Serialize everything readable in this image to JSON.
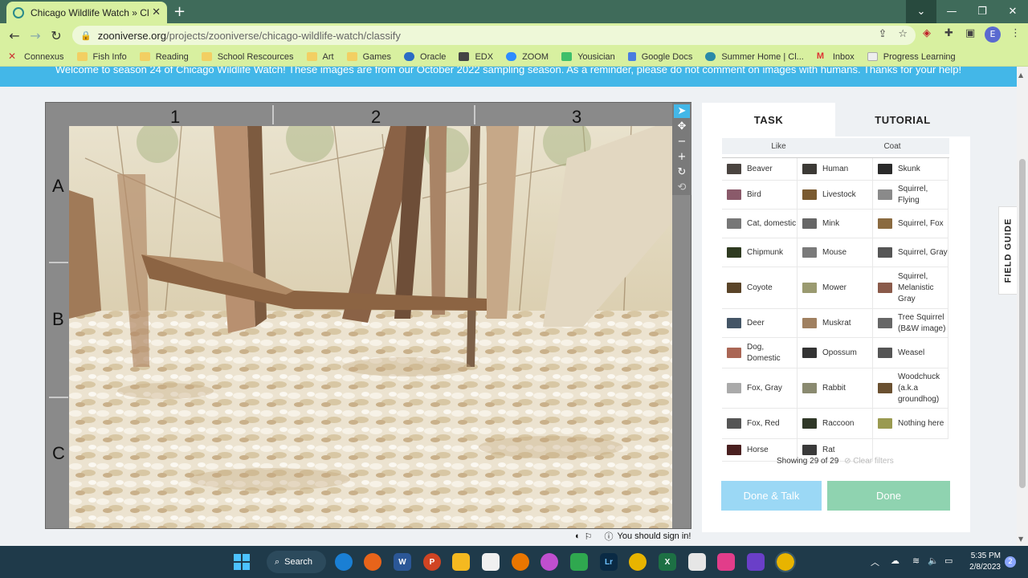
{
  "browser": {
    "tab_title": "Chicago Wildlife Watch » Classify",
    "url_host": "zooniverse.org",
    "url_path": "/projects/zooniverse/chicago-wildlife-watch/classify",
    "profile_initial": "E",
    "bookmarks": [
      "Connexus",
      "Fish Info",
      "Reading",
      "School Rescources",
      "Art",
      "Games",
      "Oracle",
      "EDX",
      "ZOOM",
      "Yousician",
      "Google Docs",
      "Summer Home | Cl...",
      "Inbox",
      "Progress Learning"
    ]
  },
  "page": {
    "banner": "Welcome to season 24 of Chicago Wildlife Watch! These images are from our October 2022 sampling season. As a reminder, please do not comment on images with humans. Thanks for your help!",
    "grid_columns": [
      "1",
      "2",
      "3"
    ],
    "grid_rows": [
      "A",
      "B",
      "C"
    ],
    "sign_in_notice": "You should sign in!"
  },
  "panel": {
    "tab_task": "TASK",
    "tab_tutorial": "TUTORIAL",
    "filter_like": "Like",
    "filter_coat": "Coat",
    "species": [
      {
        "name": "Beaver",
        "color": "#4a4440"
      },
      {
        "name": "Human",
        "color": "#3c3a36"
      },
      {
        "name": "Skunk",
        "color": "#2a2a2a"
      },
      {
        "name": "Bird",
        "color": "#8a5a6a"
      },
      {
        "name": "Livestock",
        "color": "#7a5a30"
      },
      {
        "name": "Squirrel, Flying",
        "color": "#8a8a8a"
      },
      {
        "name": "Cat, domestic",
        "color": "#777"
      },
      {
        "name": "Mink",
        "color": "#666"
      },
      {
        "name": "Squirrel, Fox",
        "color": "#8a6a40"
      },
      {
        "name": "Chipmunk",
        "color": "#2e3a20"
      },
      {
        "name": "Mouse",
        "color": "#7a7a7a"
      },
      {
        "name": "Squirrel, Gray",
        "color": "#555"
      },
      {
        "name": "Coyote",
        "color": "#5a4428"
      },
      {
        "name": "Mower",
        "color": "#9a9a70"
      },
      {
        "name": "Squirrel, Melanistic Gray",
        "color": "#8a5a4a"
      },
      {
        "name": "Deer",
        "color": "#445566"
      },
      {
        "name": "Muskrat",
        "color": "#a08060"
      },
      {
        "name": "Tree Squirrel (B&W image)",
        "color": "#666"
      },
      {
        "name": "Dog, Domestic",
        "color": "#aa6655"
      },
      {
        "name": "Opossum",
        "color": "#333"
      },
      {
        "name": "Weasel",
        "color": "#555"
      },
      {
        "name": "Fox, Gray",
        "color": "#aaa"
      },
      {
        "name": "Rabbit",
        "color": "#8a8a70"
      },
      {
        "name": "Woodchuck (a.k.a groundhog)",
        "color": "#6a5030"
      },
      {
        "name": "Fox, Red",
        "color": "#555"
      },
      {
        "name": "Raccoon",
        "color": "#303828"
      },
      {
        "name": "Nothing here",
        "color": "#9a9a50"
      },
      {
        "name": "Horse",
        "color": "#4a2020"
      },
      {
        "name": "Rat",
        "color": "#3a3a3a"
      }
    ],
    "showing": "Showing 29 of 29",
    "clear_filters": "Clear filters",
    "btn_done_talk": "Done & Talk",
    "btn_done": "Done"
  },
  "field_guide": "FIELD GUIDE",
  "taskbar": {
    "search": "Search",
    "time": "5:35 PM",
    "date": "2/8/2023",
    "notification_count": "2"
  }
}
